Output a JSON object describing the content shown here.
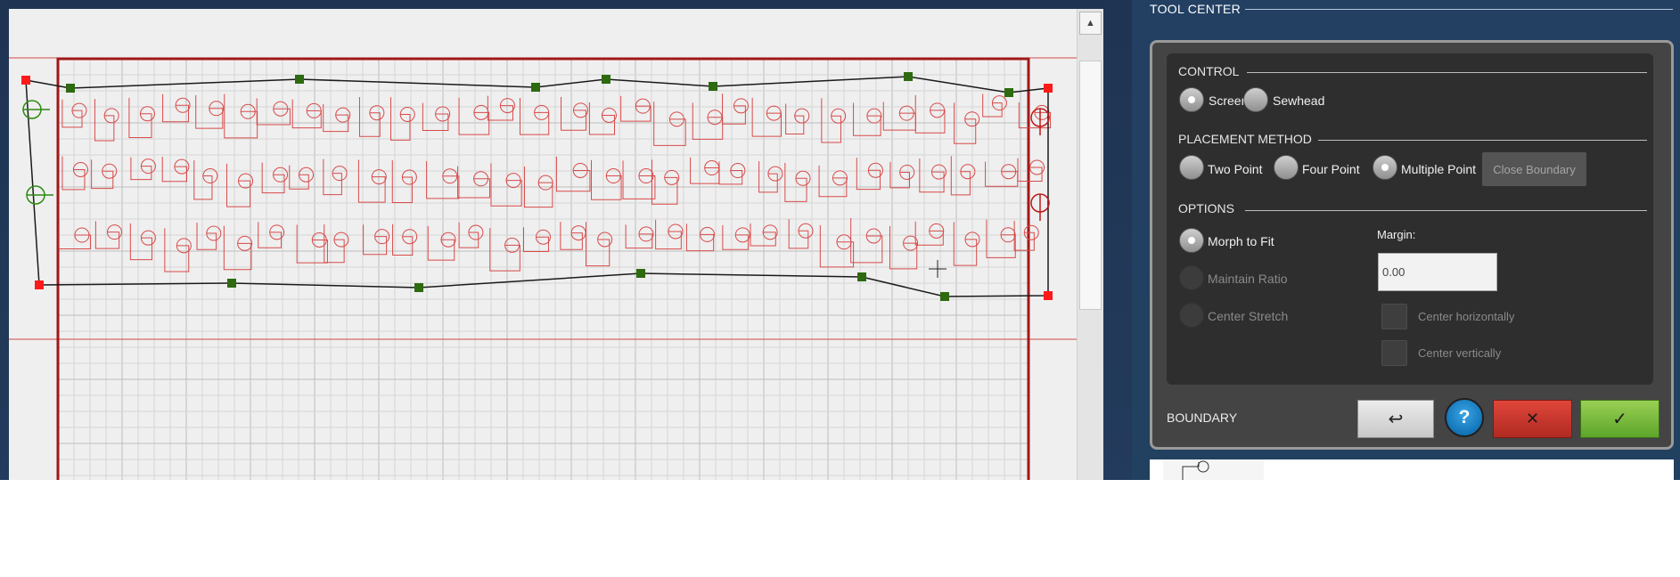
{
  "colors": {
    "background_dark": "#22405f",
    "pattern_red": "#d84a4a",
    "boundary_red": "#a01818",
    "node_green": "#2d6a10",
    "corner_red": "#ff1a1a",
    "cancel_red": "#c7352b",
    "ok_green": "#77b83b",
    "help_blue": "#1f8cd0"
  },
  "toolbar": {
    "scroll_up_icon": "triangle-up-icon"
  },
  "tool_center": {
    "title": "TOOL CENTER",
    "control": {
      "label": "CONTROL",
      "options": [
        {
          "label": "Screen",
          "selected": true
        },
        {
          "label": "Sewhead",
          "selected": false
        }
      ]
    },
    "placement": {
      "label": "PLACEMENT METHOD",
      "options": [
        {
          "label": "Two Point",
          "selected": false
        },
        {
          "label": "Four Point",
          "selected": false
        },
        {
          "label": "Multiple Point",
          "selected": true
        }
      ],
      "close_boundary_label": "Close Boundary"
    },
    "options": {
      "label": "OPTIONS",
      "items": [
        {
          "label": "Morph to Fit",
          "selected": true,
          "enabled": true
        },
        {
          "label": "Maintain Ratio",
          "selected": false,
          "enabled": false
        },
        {
          "label": "Center Stretch",
          "selected": false,
          "enabled": false
        }
      ],
      "margin_label": "Margin:",
      "margin_value": "0.00",
      "checkboxes": [
        {
          "label": "Center horizontally",
          "checked": false
        },
        {
          "label": "Center vertically",
          "checked": false
        }
      ]
    },
    "boundary_label": "BOUNDARY",
    "buttons": {
      "undo_icon": "undo-arrow-icon",
      "undo_glyph": "↩",
      "help_glyph": "?",
      "cancel_glyph": "✕",
      "ok_glyph": "✓"
    }
  }
}
